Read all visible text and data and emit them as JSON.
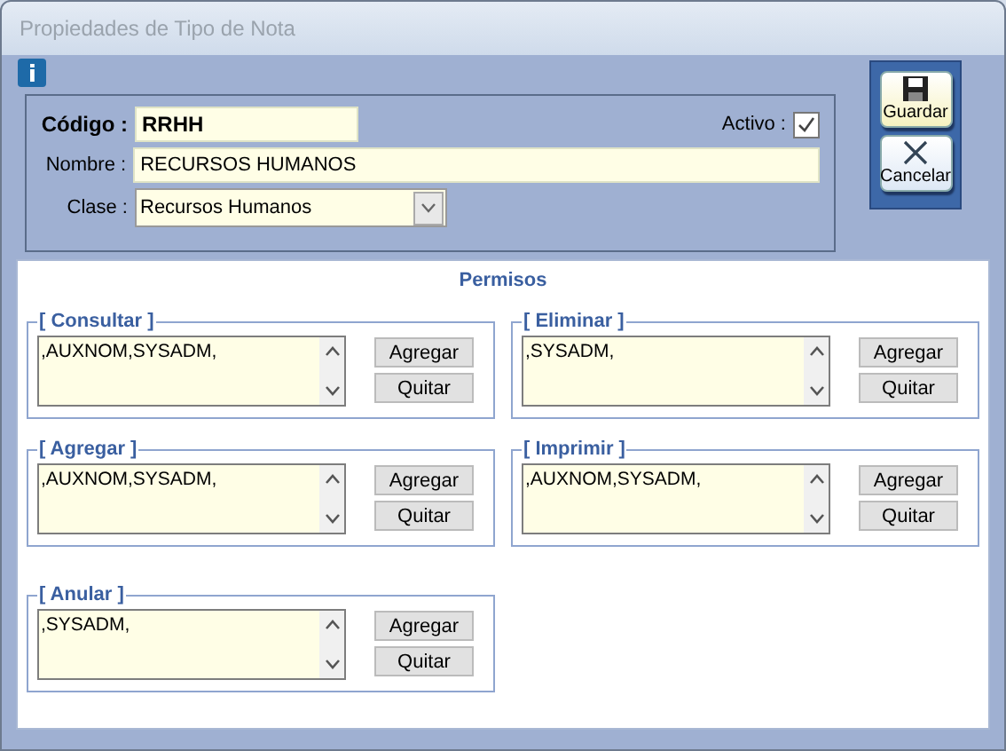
{
  "window": {
    "title": "Propiedades de Tipo de Nota"
  },
  "header": {
    "codigo": {
      "label": "Código :",
      "value": "RRHH"
    },
    "activo": {
      "label": "Activo :",
      "checked": true
    },
    "nombre": {
      "label": "Nombre :",
      "value": "RECURSOS HUMANOS"
    },
    "clase": {
      "label": "Clase :",
      "value": "Recursos Humanos"
    }
  },
  "actions": [
    {
      "kind": "save",
      "label": "Guardar"
    },
    {
      "kind": "cancel",
      "label": "Cancelar"
    }
  ],
  "permisos": {
    "title": "Permisos",
    "groups": [
      {
        "label": "[ Consultar ]",
        "value": ",AUXNOM,SYSADM,",
        "buttons": [
          "Agregar",
          "Quitar"
        ]
      },
      {
        "label": "[ Eliminar ]",
        "value": ",SYSADM,",
        "buttons": [
          "Agregar",
          "Quitar"
        ]
      },
      {
        "label": "[ Agregar ]",
        "value": ",AUXNOM,SYSADM,",
        "buttons": [
          "Agregar",
          "Quitar"
        ]
      },
      {
        "label": "[ Imprimir ]",
        "value": ",AUXNOM,SYSADM,",
        "buttons": [
          "Agregar",
          "Quitar"
        ]
      },
      {
        "label": "[ Anular ]",
        "value": ",SYSADM,",
        "buttons": [
          "Agregar",
          "Quitar"
        ]
      }
    ]
  }
}
